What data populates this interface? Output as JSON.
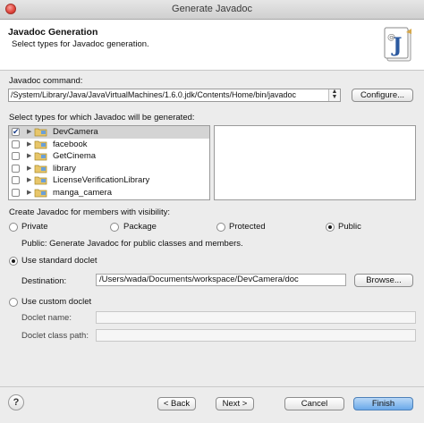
{
  "window": {
    "title": "Generate Javadoc"
  },
  "header": {
    "title": "Javadoc Generation",
    "subtitle": "Select types for Javadoc generation.",
    "icon": "javadoc-wizard-icon"
  },
  "javadoc_command": {
    "label": "Javadoc command:",
    "value": "/System/Library/Java/JavaVirtualMachines/1.6.0.jdk/Contents/Home/bin/javadoc",
    "configure_label": "Configure..."
  },
  "types": {
    "label": "Select types for which Javadoc will be generated:",
    "items": [
      {
        "name": "DevCamera",
        "checked": true,
        "selected": true
      },
      {
        "name": "facebook",
        "checked": false,
        "selected": false
      },
      {
        "name": "GetCinema",
        "checked": false,
        "selected": false
      },
      {
        "name": "library",
        "checked": false,
        "selected": false
      },
      {
        "name": "LicenseVerificationLibrary",
        "checked": false,
        "selected": false
      },
      {
        "name": "manga_camera",
        "checked": false,
        "selected": false
      }
    ]
  },
  "visibility": {
    "label": "Create Javadoc for members with visibility:",
    "options": [
      "Private",
      "Package",
      "Protected",
      "Public"
    ],
    "selected": "Public",
    "description": "Public: Generate Javadoc for public classes and members."
  },
  "standard_doclet": {
    "label": "Use standard doclet",
    "selected": true,
    "destination_label": "Destination:",
    "destination_value": "/Users/wada/Documents/workspace/DevCamera/doc",
    "browse_label": "Browse..."
  },
  "custom_doclet": {
    "label": "Use custom doclet",
    "selected": false,
    "name_label": "Doclet name:",
    "name_value": "",
    "classpath_label": "Doclet class path:",
    "classpath_value": ""
  },
  "footer": {
    "help_label": "?",
    "back_label": "< Back",
    "next_label": "Next >",
    "cancel_label": "Cancel",
    "finish_label": "Finish"
  }
}
